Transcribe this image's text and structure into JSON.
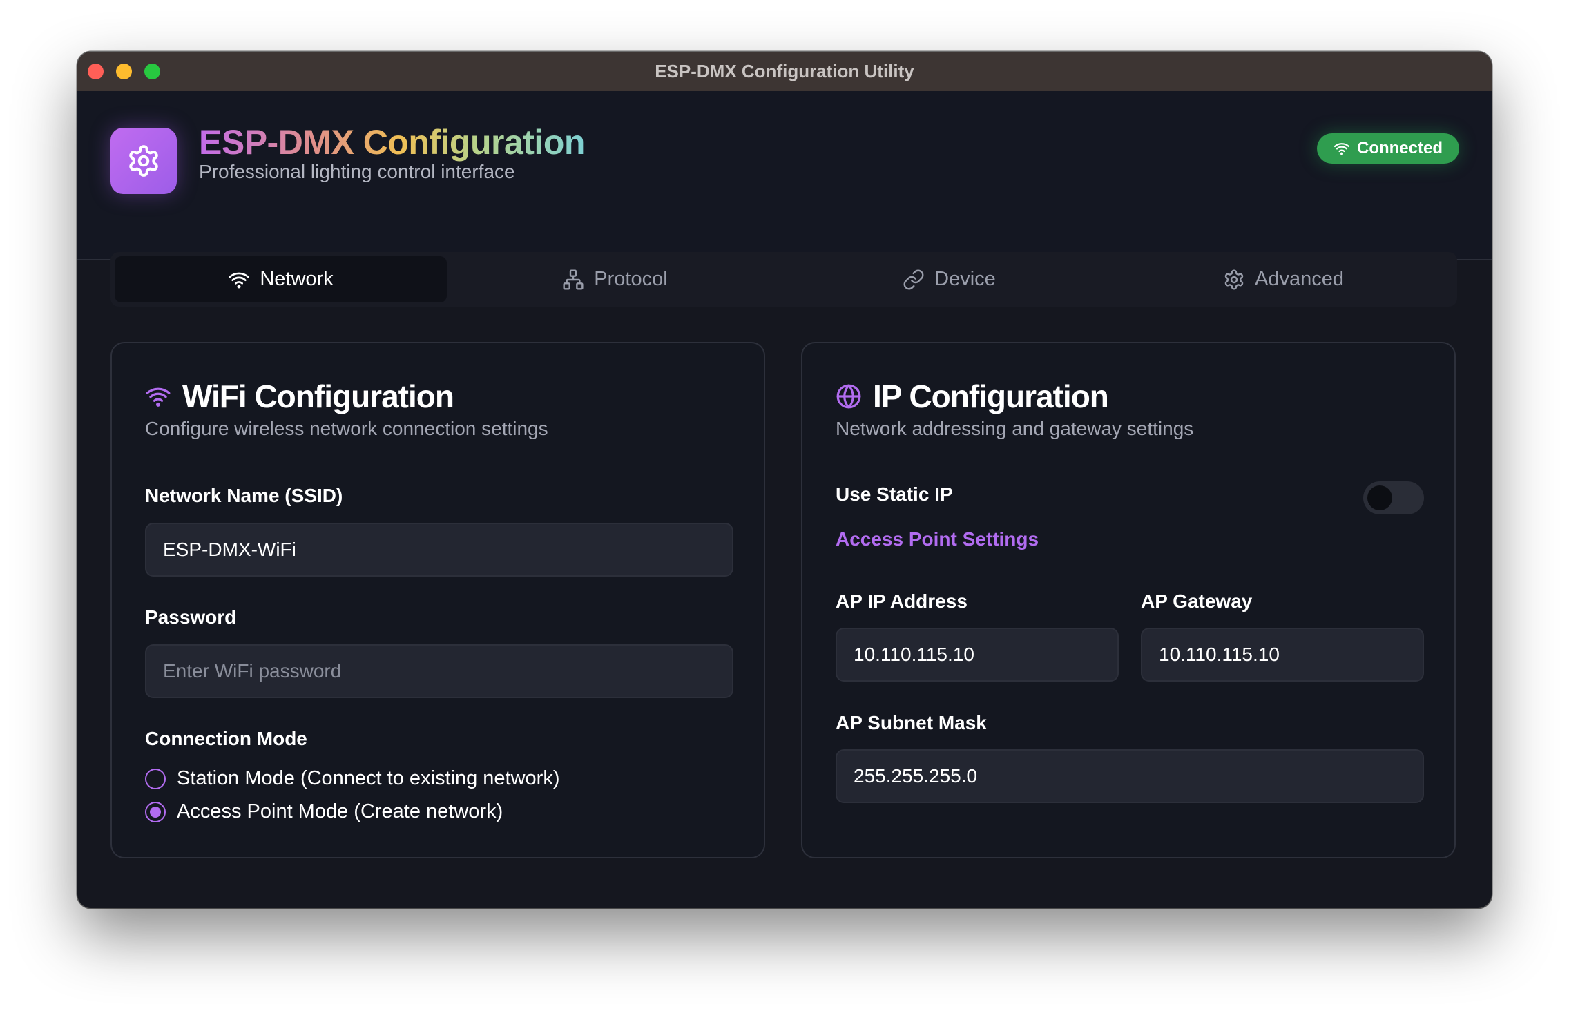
{
  "window": {
    "title": "ESP-DMX Configuration Utility"
  },
  "header": {
    "app_icon": "gear-icon",
    "title": "ESP-DMX Configuration",
    "subtitle": "Professional lighting control interface",
    "status": {
      "icon": "wifi-icon",
      "label": "Connected",
      "color": "#2f9d4f"
    }
  },
  "tabs": [
    {
      "icon": "wifi-icon",
      "label": "Network",
      "active": true
    },
    {
      "icon": "network-nodes-icon",
      "label": "Protocol",
      "active": false
    },
    {
      "icon": "link-icon",
      "label": "Device",
      "active": false
    },
    {
      "icon": "gear-icon",
      "label": "Advanced",
      "active": false
    }
  ],
  "wifi": {
    "icon": "wifi-icon",
    "title": "WiFi Configuration",
    "description": "Configure wireless network connection settings",
    "ssid": {
      "label": "Network Name (SSID)",
      "value": "ESP-DMX-WiFi"
    },
    "password": {
      "label": "Password",
      "value": "",
      "placeholder": "Enter WiFi password"
    },
    "connection_mode": {
      "label": "Connection Mode",
      "options": [
        {
          "label": "Station Mode (Connect to existing network)",
          "selected": false
        },
        {
          "label": "Access Point Mode (Create network)",
          "selected": true
        }
      ]
    }
  },
  "ip": {
    "icon": "globe-icon",
    "title": "IP Configuration",
    "description": "Network addressing and gateway settings",
    "static_ip": {
      "label": "Use Static IP",
      "enabled": false
    },
    "section_heading": "Access Point Settings",
    "ap_ip": {
      "label": "AP IP Address",
      "value": "10.110.115.10"
    },
    "ap_gateway": {
      "label": "AP Gateway",
      "value": "10.110.115.10"
    },
    "ap_subnet": {
      "label": "AP Subnet Mask",
      "value": "255.255.255.0"
    }
  },
  "colors": {
    "accent": "#b26cf0",
    "background": "#15171f",
    "card": "#141720",
    "success": "#2f9d4f"
  }
}
